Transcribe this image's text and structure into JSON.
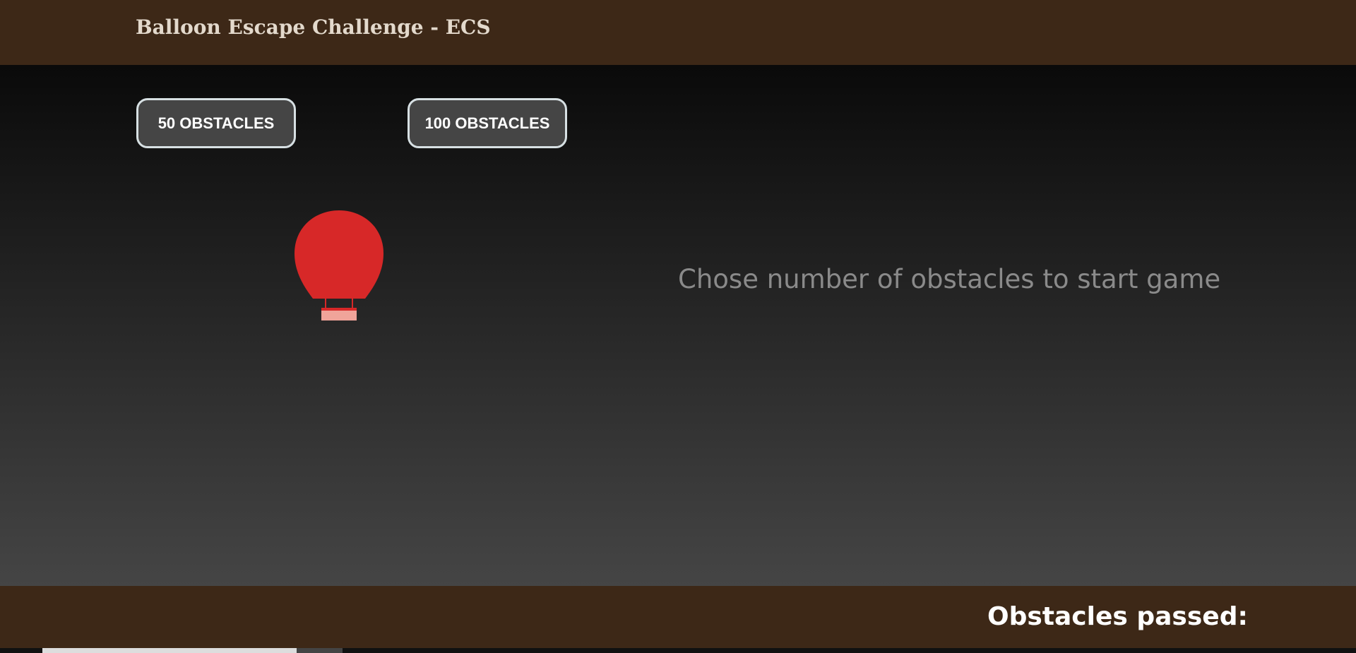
{
  "header": {
    "title": "Balloon Escape Challenge - ECS"
  },
  "controls": {
    "btn_50_label": "50 OBSTACLES",
    "btn_100_label": "100 OBSTACLES"
  },
  "game": {
    "message": "Chose number of obstacles to start game",
    "balloon_color": "#d72828",
    "basket_color": "#f0a49a"
  },
  "footer": {
    "obstacles_passed_label": "Obstacles passed:"
  },
  "colors": {
    "header_bg": "#3d2817",
    "footer_bg": "#3d2817",
    "button_bg": "#454545",
    "button_border": "#d7e0e3",
    "message_color": "#8a8a8a"
  }
}
